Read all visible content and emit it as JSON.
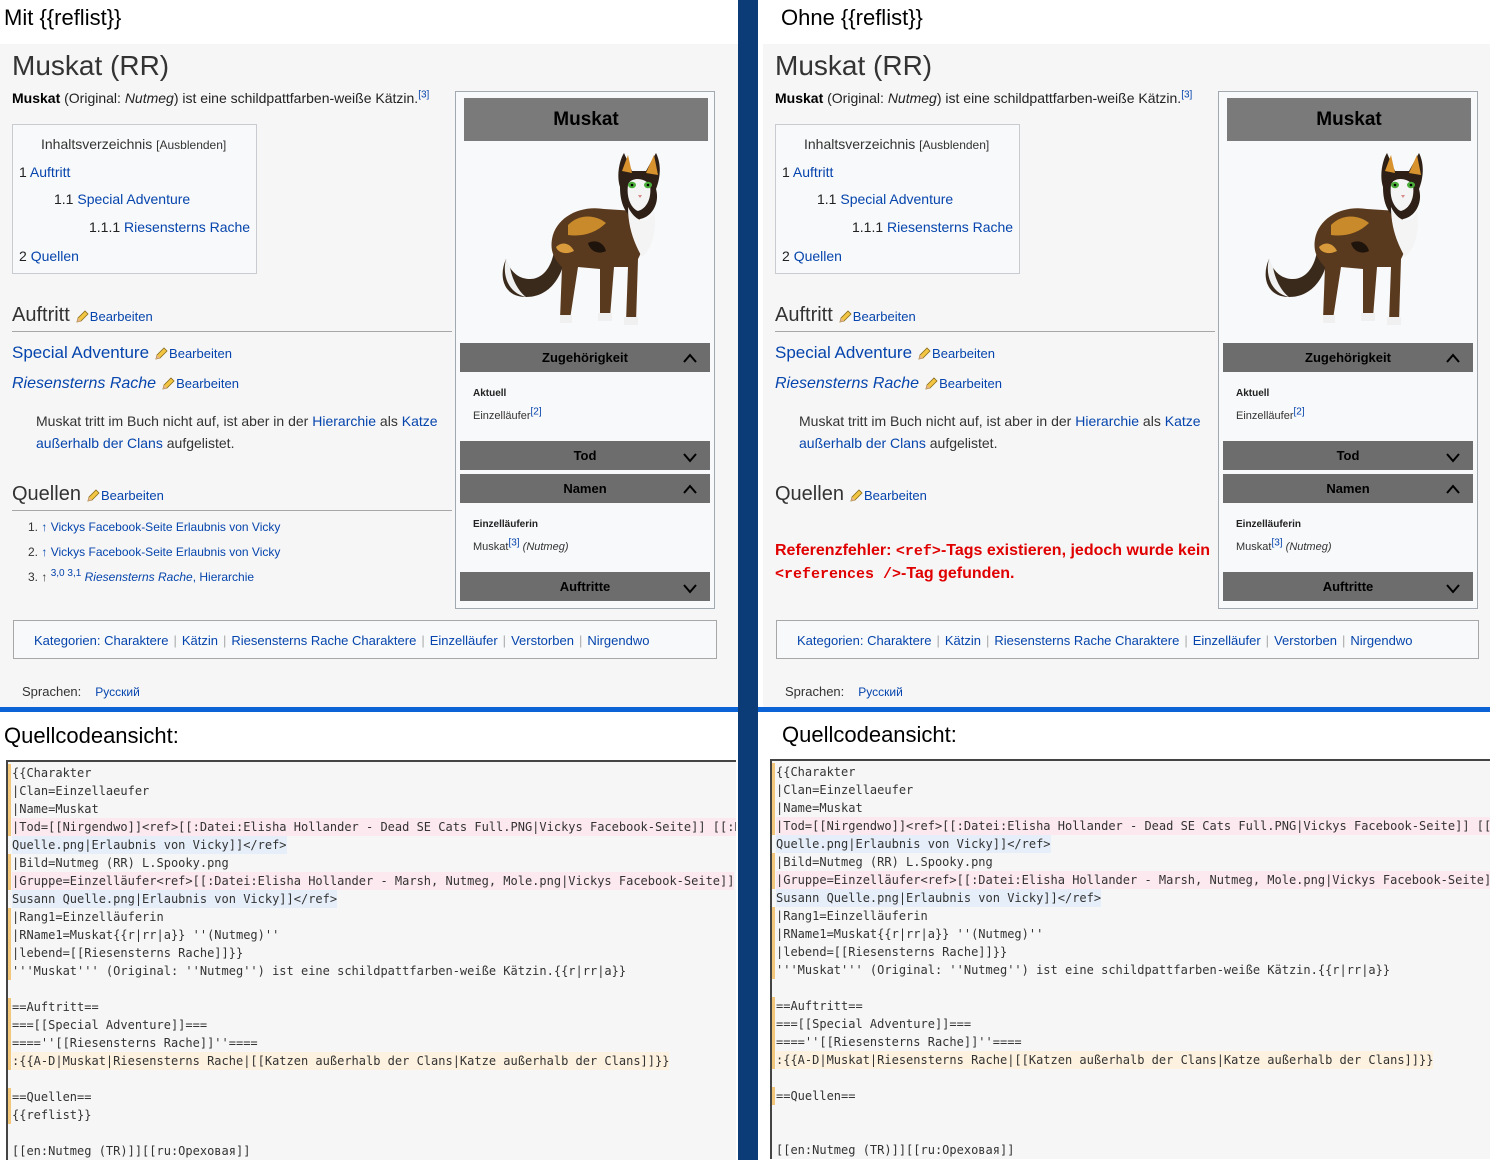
{
  "left_header": "Mit {{reflist}}",
  "right_header": "Ohne {{reflist}}",
  "source_header": "Quellcodeansicht:",
  "page_title": "Muskat (RR)",
  "intro": {
    "bold": "Muskat",
    "pre": " (Original: ",
    "italic": "Nutmeg",
    "post": ") ist eine schildpattfarben-weiße Kätzin.",
    "ref": "[3]"
  },
  "toc": {
    "title": "Inhaltsverzeichnis",
    "hide": "[Ausblenden]",
    "items": [
      {
        "num": "1",
        "label": "Auftritt"
      },
      {
        "num": "1.1",
        "label": "Special Adventure"
      },
      {
        "num": "1.1.1",
        "label": "Riesensterns Rache"
      },
      {
        "num": "2",
        "label": "Quellen"
      }
    ]
  },
  "sections": {
    "auftritt": "Auftritt",
    "special": "Special Adventure",
    "riesen": "Riesensterns Rache",
    "quellen": "Quellen",
    "edit": "Bearbeiten"
  },
  "body": {
    "pre": "Muskat tritt im Buch nicht auf, ist aber in der ",
    "link1": "Hierarchie",
    "mid": " als ",
    "link2a": "Katze",
    "link2b": "außerhalb der Clans",
    "post": " aufgelistet."
  },
  "references": [
    {
      "num": "1.",
      "arrow": "↑",
      "text": "Vickys Facebook-Seite Erlaubnis von Vicky"
    },
    {
      "num": "2.",
      "arrow": "↑",
      "text": "Vickys Facebook-Seite Erlaubnis von Vicky"
    },
    {
      "num": "3.",
      "arrow": "↑",
      "backrefs": "3,0 3,1",
      "italic": "Riesensterns Rache",
      "text": ", Hierarchie"
    }
  ],
  "ref_error": {
    "pre": "Referenzfehler: ",
    "code1": "<ref>",
    "mid": "-Tags existieren, jedoch wurde kein ",
    "code2": "<references />",
    "post": "-Tag gefunden."
  },
  "infobox": {
    "title": "Muskat",
    "sec_affiliation": "Zugehörigkeit",
    "label_current": "Aktuell",
    "val_current": "Einzelläufer",
    "val_current_ref": "[2]",
    "sec_death": "Tod",
    "sec_names": "Namen",
    "label_names": "Einzelläuferin",
    "val_names": "Muskat",
    "val_names_ref": "[3]",
    "val_names_italic": "(Nutmeg)",
    "sec_appearances": "Auftritte"
  },
  "categories": {
    "label": "Kategorien:",
    "items": [
      "Charaktere",
      "Kätzin",
      "Riesensterns Rache Charaktere",
      "Einzelläufer",
      "Verstorben",
      "Nirgendwo"
    ]
  },
  "languages": {
    "label": "Sprachen:",
    "item": "Русский"
  },
  "colors": {
    "divider": "#0b3c78",
    "rule": "#0b63d6",
    "link": "#0645ad",
    "error": "#e00000"
  },
  "source_left": [
    "{{Charakter",
    "|Clan=Einzellaeufer",
    "|Name=Muskat",
    "|Tod=[[Nirgendwo]]<ref>[[:Datei:Elisha Hollander - Dead SE Cats Full.PNG|Vickys Facebook-Seite]] [[:D",
    "Quelle.png|Erlaubnis von Vicky]]</ref>",
    "|Bild=Nutmeg (RR) L.Spooky.png",
    "|Gruppe=Einzelläufer<ref>[[:Datei:Elisha Hollander - Marsh, Nutmeg, Mole.png|Vickys Facebook-Seite]]",
    "Susann Quelle.png|Erlaubnis von Vicky]]</ref>",
    "|Rang1=Einzelläuferin",
    "|RName1=Muskat{{r|rr|a}} ''(Nutmeg)''",
    "|lebend=[[Riesensterns Rache]]}}",
    "'''Muskat''' (Original: ''Nutmeg'') ist eine schildpattfarben-weiße Kätzin.{{r|rr|a}}",
    "",
    "==Auftritt==",
    "===[[Special Adventure]]===",
    "====''[[Riesensterns Rache]]''====",
    ":{{A-D|Muskat|Riesensterns Rache|[[Katzen außerhalb der Clans|Katze außerhalb der Clans]]}}",
    "",
    "==Quellen==",
    "{{reflist}}",
    "",
    "[[en:Nutmeg (TR)]][[ru:Ореховая]]"
  ],
  "source_right": [
    "{{Charakter",
    "|Clan=Einzellaeufer",
    "|Name=Muskat",
    "|Tod=[[Nirgendwo]]<ref>[[:Datei:Elisha Hollander - Dead SE Cats Full.PNG|Vickys Facebook-Seite]] [[:D",
    "Quelle.png|Erlaubnis von Vicky]]</ref>",
    "|Bild=Nutmeg (RR) L.Spooky.png",
    "|Gruppe=Einzelläufer<ref>[[:Datei:Elisha Hollander - Marsh, Nutmeg, Mole.png|Vickys Facebook-Seite]]",
    "Susann Quelle.png|Erlaubnis von Vicky]]</ref>",
    "|Rang1=Einzelläuferin",
    "|RName1=Muskat{{r|rr|a}} ''(Nutmeg)''",
    "|lebend=[[Riesensterns Rache]]}}",
    "'''Muskat''' (Original: ''Nutmeg'') ist eine schildpattfarben-weiße Kätzin.{{r|rr|a}}",
    "",
    "==Auftritt==",
    "===[[Special Adventure]]===",
    "====''[[Riesensterns Rache]]''====",
    ":{{A-D|Muskat|Riesensterns Rache|[[Katzen außerhalb der Clans|Katze außerhalb der Clans]]}}",
    "",
    "==Quellen==",
    "",
    "",
    "[[en:Nutmeg (TR)]][[ru:Ореховая]]"
  ]
}
